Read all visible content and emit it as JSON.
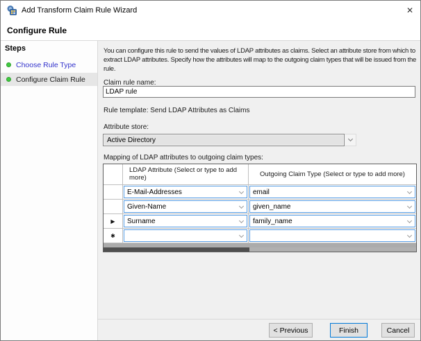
{
  "window": {
    "title": "Add Transform Claim Rule Wizard",
    "close_glyph": "✕"
  },
  "header": {
    "title": "Configure Rule"
  },
  "sidebar": {
    "title": "Steps",
    "items": [
      {
        "label": "Choose Rule Type",
        "state": "completed"
      },
      {
        "label": "Configure Claim Rule",
        "state": "current"
      }
    ]
  },
  "main": {
    "description": "You can configure this rule to send the values of LDAP attributes as claims. Select an attribute store from which to extract LDAP attributes. Specify how the attributes will map to the outgoing claim types that will be issued from the rule.",
    "claim_rule_name": {
      "label": "Claim rule name:",
      "value": "LDAP rule"
    },
    "rule_template": "Rule template: Send LDAP Attributes as Claims",
    "attribute_store": {
      "label": "Attribute store:",
      "value": "Active Directory"
    },
    "mapping": {
      "label": "Mapping of LDAP attributes to outgoing claim types:",
      "columns": [
        "LDAP Attribute (Select or type to add more)",
        "Outgoing Claim Type (Select or type to add more)"
      ],
      "rows": [
        {
          "indicator": "",
          "ldap_attribute": "E-Mail-Addresses",
          "outgoing_claim_type": "email"
        },
        {
          "indicator": "",
          "ldap_attribute": "Given-Name",
          "outgoing_claim_type": "given_name"
        },
        {
          "indicator": "▶",
          "ldap_attribute": "Surname",
          "outgoing_claim_type": "family_name"
        },
        {
          "indicator": "✱",
          "ldap_attribute": "",
          "outgoing_claim_type": ""
        }
      ]
    }
  },
  "footer": {
    "buttons": [
      {
        "label": "< Previous"
      },
      {
        "label": "Finish",
        "focused": true
      },
      {
        "label": "Cancel"
      }
    ]
  },
  "colors": {
    "accent_focus": "#0078d7",
    "step_link": "#3333cc",
    "step_bullet": "#3fcb3f",
    "grid_combo_border": "#569de5",
    "content_background": "#f0f0f0"
  }
}
